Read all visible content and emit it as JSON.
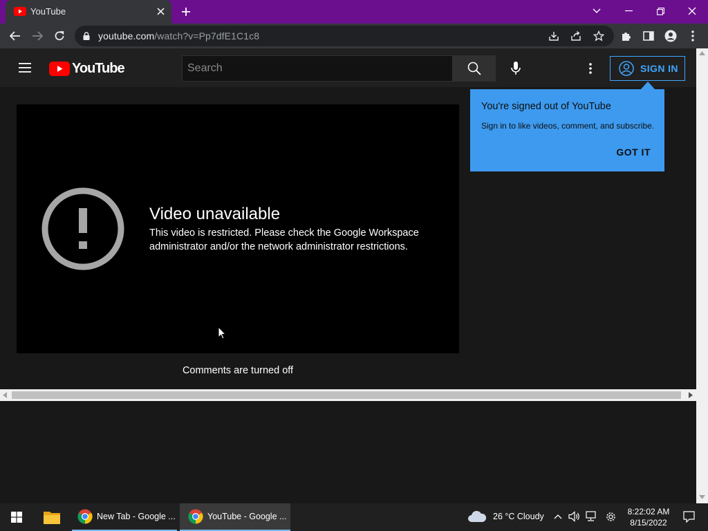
{
  "browser": {
    "tab_title": "YouTube",
    "url_host": "youtube.com",
    "url_path": "/watch?v=Pp7dfE1C1c8"
  },
  "masthead": {
    "logo_text": "YouTube",
    "search_placeholder": "Search",
    "signin_label": "SIGN IN"
  },
  "player": {
    "error_title": "Video unavailable",
    "error_message": "This video is restricted. Please check the Google Workspace administrator and/or the network administrator restrictions."
  },
  "comments_text": "Comments are turned off",
  "popup": {
    "title": "You're signed out of YouTube",
    "text": "Sign in to like videos, comment, and subscribe.",
    "button": "GOT IT"
  },
  "taskbar": {
    "apps": [
      {
        "label": "New Tab - Google ..."
      },
      {
        "label": "YouTube - Google ..."
      }
    ],
    "weather": "26 °C  Cloudy",
    "time": "8:22:02 AM",
    "date": "8/15/2022"
  },
  "colors": {
    "titlebar": "#6b0f8f",
    "accent_blue": "#3ea6ff",
    "youtube_red": "#ff0000"
  }
}
